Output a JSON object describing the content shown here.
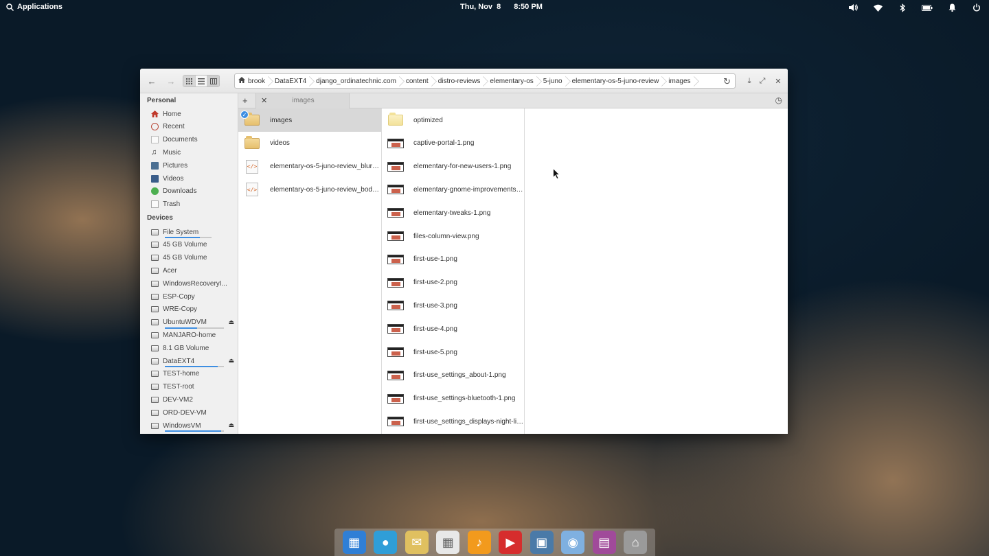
{
  "panel": {
    "applications_label": "Applications",
    "date": "Thu, Nov  8",
    "time": "8:50 PM"
  },
  "pathbar": {
    "crumbs": [
      "brook",
      "DataEXT4",
      "django_ordinatechnic.com",
      "content",
      "distro-reviews",
      "elementary-os",
      "5-juno",
      "elementary-os-5-juno-review",
      "images"
    ]
  },
  "tab": {
    "label": "images"
  },
  "sidebar": {
    "personal_heading": "Personal",
    "devices_heading": "Devices",
    "personal": [
      {
        "label": "Home",
        "icon": "home-icon"
      },
      {
        "label": "Recent",
        "icon": "recent-icon"
      },
      {
        "label": "Documents",
        "icon": "documents-icon"
      },
      {
        "label": "Music",
        "icon": "music-icon"
      },
      {
        "label": "Pictures",
        "icon": "pictures-icon"
      },
      {
        "label": "Videos",
        "icon": "videos-icon"
      },
      {
        "label": "Downloads",
        "icon": "downloads-icon"
      },
      {
        "label": "Trash",
        "icon": "trash-icon"
      }
    ],
    "devices": [
      {
        "label": "File System",
        "usage": 0.75,
        "eject": false
      },
      {
        "label": "45 GB Volume",
        "usage": null,
        "eject": false
      },
      {
        "label": "45 GB Volume",
        "usage": null,
        "eject": false
      },
      {
        "label": "Acer",
        "usage": null,
        "eject": false
      },
      {
        "label": "WindowsRecoveryI...",
        "usage": null,
        "eject": false
      },
      {
        "label": "ESP-Copy",
        "usage": null,
        "eject": false
      },
      {
        "label": "WRE-Copy",
        "usage": null,
        "eject": false
      },
      {
        "label": "UbuntuWDVM",
        "usage": 0.55,
        "eject": true
      },
      {
        "label": "MANJARO-home",
        "usage": null,
        "eject": false
      },
      {
        "label": "8.1 GB Volume",
        "usage": null,
        "eject": false
      },
      {
        "label": "DataEXT4",
        "usage": 0.9,
        "eject": true
      },
      {
        "label": "TEST-home",
        "usage": null,
        "eject": false
      },
      {
        "label": "TEST-root",
        "usage": null,
        "eject": false
      },
      {
        "label": "DEV-VM2",
        "usage": null,
        "eject": false
      },
      {
        "label": "ORD-DEV-VM",
        "usage": null,
        "eject": false
      },
      {
        "label": "WindowsVM",
        "usage": 0.95,
        "eject": true
      }
    ]
  },
  "column1": [
    {
      "name": "images",
      "type": "folder",
      "selected": true
    },
    {
      "name": "videos",
      "type": "folder",
      "selected": false
    },
    {
      "name": "elementary-os-5-juno-review_blurb....",
      "type": "code",
      "selected": false
    },
    {
      "name": "elementary-os-5-juno-review_body.h...",
      "type": "code",
      "selected": false
    }
  ],
  "column2": [
    {
      "name": "optimized",
      "type": "folder-light"
    },
    {
      "name": "captive-portal-1.png",
      "type": "png"
    },
    {
      "name": "elementary-for-new-users-1.png",
      "type": "png"
    },
    {
      "name": "elementary-gnome-improvements-1...",
      "type": "png"
    },
    {
      "name": "elementary-tweaks-1.png",
      "type": "png"
    },
    {
      "name": "files-column-view.png",
      "type": "png"
    },
    {
      "name": "first-use-1.png",
      "type": "png"
    },
    {
      "name": "first-use-2.png",
      "type": "png"
    },
    {
      "name": "first-use-3.png",
      "type": "png"
    },
    {
      "name": "first-use-4.png",
      "type": "png"
    },
    {
      "name": "first-use-5.png",
      "type": "png"
    },
    {
      "name": "first-use_settings_about-1.png",
      "type": "png"
    },
    {
      "name": "first-use_settings-bluetooth-1.png",
      "type": "png"
    },
    {
      "name": "first-use_settings_displays-night-ligh...",
      "type": "png"
    }
  ],
  "dock": [
    {
      "icon": "multitasking-view-icon",
      "color": "#2f7fd6"
    },
    {
      "icon": "web-browser-icon",
      "color": "#2f9ed8"
    },
    {
      "icon": "mail-icon",
      "color": "#e0c060"
    },
    {
      "icon": "calendar-icon",
      "color": "#e8e8e8"
    },
    {
      "icon": "music-player-icon",
      "color": "#f29a1d"
    },
    {
      "icon": "videos-app-icon",
      "color": "#d62d2d"
    },
    {
      "icon": "photos-icon",
      "color": "#4a7aa8"
    },
    {
      "icon": "settings-icon",
      "color": "#7fb0e0"
    },
    {
      "icon": "appcenter-icon",
      "color": "#a04a9a"
    },
    {
      "icon": "files-icon",
      "color": "#9a9a9a"
    }
  ]
}
